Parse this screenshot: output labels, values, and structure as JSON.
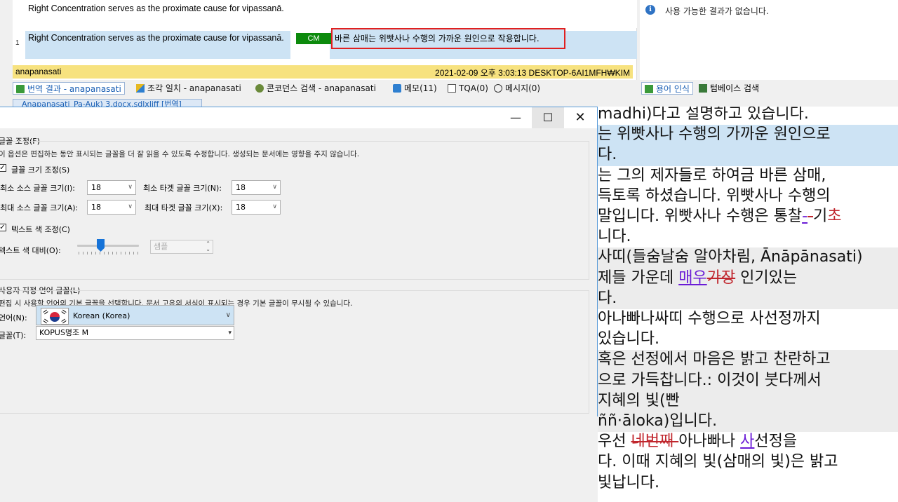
{
  "results": {
    "row1_source": "Right Concentration serves as the proximate cause for vipassanā.",
    "row2_number": "1",
    "row2_source": "Right Concentration serves as the proximate cause for vipassanā.",
    "row2_badge": "CM",
    "row2_target": "바른 삼매는 위빳사나 수행의 가까운 원인으로 작용합니다.",
    "status_left": "anapanasati",
    "status_right": "2021-02-09 오후 3:03:13  DESKTOP-6AI1MFH₩KIM"
  },
  "info_panel": {
    "message": "사용 가능한 결과가 없습니다."
  },
  "tabs": [
    {
      "label": "번역 결과 - anapanasati",
      "icon": "results-icon"
    },
    {
      "label": "조각 일치 - anapanasati",
      "icon": "fragment-icon"
    },
    {
      "label": "콘코던스 검색 - anapanasati",
      "icon": "concordance-icon"
    },
    {
      "label": "메모(11)",
      "icon": "memo-icon"
    },
    {
      "label": "TQA(0)",
      "icon": "tqa-icon"
    },
    {
      "label": "메시지(0)",
      "icon": "message-icon"
    }
  ],
  "tabs_right": [
    {
      "label": "용어 인식",
      "icon": "term-recognition-icon"
    },
    {
      "label": "텀베이스 검색",
      "icon": "termbase-search-icon"
    }
  ],
  "doc_tab": "Anapanasati_Pa-Auk) 3.docx.sdlxliff [번역]",
  "dialog": {
    "window_buttons": {
      "minimize": "—",
      "maximize": "☐",
      "close": "✕"
    },
    "font_section_title": "글꼴 조정(F)",
    "font_section_desc": "이 옵션은 편집하는 동안 표시되는 글꼴을 더 잘 읽을 수 있도록 수정합니다. 생성되는 문서에는 영향을 주지 않습니다.",
    "font_size_checkbox": "글꼴 크기 조정(S)",
    "min_source_label": "최소 소스 글꼴 크기(I):",
    "min_source_value": "18",
    "min_target_label": "최소 타겟 글꼴 크기(N):",
    "min_target_value": "18",
    "max_source_label": "최대 소스 글꼴 크기(A):",
    "max_source_value": "18",
    "max_target_label": "최대 타겟 글꼴 크기(X):",
    "max_target_value": "18",
    "text_color_checkbox": "텍스트 색 조정(C)",
    "contrast_label": "텍스트 색 대비(O):",
    "sample_placeholder": "샘플",
    "custom_lang_title": "사용자 지정 언어 글꼴(L)",
    "custom_lang_desc": "편집 시 사용할 언어의 기본 글꼴을 선택합니다. 문서 고유의 서식이 표시되는 경우 기본 글꼴이 무시될 수 있습니다.",
    "language_label": "언어(N):",
    "language_value": "Korean (Korea)",
    "font_label": "글꼴(T):",
    "font_value": "KOPUS명조 M"
  },
  "editor": {
    "lines": [
      {
        "parts": [
          {
            "t": "madhi)다고 설명하고 있습니다.",
            "c": ""
          }
        ],
        "bg": ""
      },
      {
        "parts": [
          {
            "t": "는 위빳사나 수행의 가까운 원인으로",
            "c": ""
          }
        ],
        "bg": "hl"
      },
      {
        "parts": [
          {
            "t": "다.",
            "c": ""
          }
        ],
        "bg": "hl"
      },
      {
        "parts": [
          {
            "t": "는 그의 제자들로 하여금 바른 삼매,",
            "c": ""
          }
        ],
        "bg": ""
      },
      {
        "parts": [
          {
            "t": "득토록 하셨습니다. 위빳사나 수행의",
            "c": ""
          }
        ],
        "bg": ""
      },
      {
        "parts": [
          {
            "t": "말입니다. 위빳사나 수행은 통찰",
            "c": ""
          },
          {
            "t": "-",
            "c": "ins"
          },
          {
            "t": "-",
            "c": "del"
          },
          {
            "t": "기",
            "c": ""
          },
          {
            "t": "초",
            "c": "del2"
          }
        ],
        "bg": ""
      },
      {
        "parts": [
          {
            "t": "니다.",
            "c": ""
          }
        ],
        "bg": ""
      },
      {
        "parts": [
          {
            "t": "사띠(들숨날숨 알아차림, Ānāpānasati)",
            "c": ""
          }
        ],
        "bg": "gy"
      },
      {
        "parts": [
          {
            "t": "제들 가운데 ",
            "c": ""
          },
          {
            "t": "매우",
            "c": "ins"
          },
          {
            "t": "가장",
            "c": "del"
          },
          {
            "t": " 인기있는",
            "c": ""
          }
        ],
        "bg": "gy"
      },
      {
        "parts": [
          {
            "t": "다.",
            "c": ""
          }
        ],
        "bg": "gy"
      },
      {
        "parts": [
          {
            "t": "아나빠나싸띠 수행으로 사선정까지",
            "c": ""
          }
        ],
        "bg": ""
      },
      {
        "parts": [
          {
            "t": "있습니다.",
            "c": ""
          }
        ],
        "bg": ""
      },
      {
        "parts": [
          {
            "t": "혹은 선정에서 마음은 밝고 찬란하고",
            "c": ""
          }
        ],
        "bg": "gy"
      },
      {
        "parts": [
          {
            "t": "으로 가득찹니다.: 이것이 붓다께서",
            "c": ""
          }
        ],
        "bg": "gy"
      },
      {
        "parts": [
          {
            "t": "지혜의 빛(빤",
            "c": ""
          }
        ],
        "bg": "gy"
      },
      {
        "parts": [
          {
            "t": "ññ·āloka)입니다.",
            "c": ""
          }
        ],
        "bg": "gy"
      },
      {
        "parts": [
          {
            "t": "우선 ",
            "c": ""
          },
          {
            "t": "네번째 ",
            "c": "del"
          },
          {
            "t": "아나빠나 ",
            "c": ""
          },
          {
            "t": "사",
            "c": "ins"
          },
          {
            "t": "선정을",
            "c": ""
          }
        ],
        "bg": ""
      },
      {
        "parts": [
          {
            "t": "다. 이때 지혜의 빛(삼매의 빛)은 밝고",
            "c": ""
          }
        ],
        "bg": ""
      },
      {
        "parts": [
          {
            "t": "빛납니다.",
            "c": ""
          }
        ],
        "bg": ""
      }
    ]
  }
}
